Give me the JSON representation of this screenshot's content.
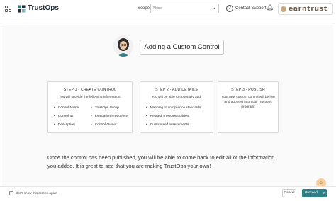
{
  "header": {
    "brand_name": "TrustOps",
    "scope_label": "Scope",
    "scope_value": "None",
    "contact_label": "Contact Support",
    "account_name": "earntrust"
  },
  "modal": {
    "title": "Adding a Custom Control",
    "steps": [
      {
        "title": "STEP 1 - CREATE CONTROL",
        "description": "You will provide the following information:",
        "items_col1": [
          "Control Name",
          "Control ID",
          "Description"
        ],
        "items_col2": [
          "TrustOps Group",
          "Evaluation Frequency",
          "Control Owner"
        ]
      },
      {
        "title": "STEP 2 - ADD DETAILS",
        "description": "You will be able to optionally add:",
        "items": [
          "Mapping to compliance standards",
          "Related TrustOps policies",
          "Custom self assessments"
        ]
      },
      {
        "title": "STEP 3 - PUBLISH",
        "description": "Your new custom control will be live and adopted into your TrustOps program!"
      }
    ],
    "bottom_text": "Once the control has been published, you will be able to come back to edit all of the information you added. It is great to see that you are making TrustOps your own!"
  },
  "footer": {
    "dont_show_label": "Don't show this screen again",
    "cancel_label": "Cancel",
    "proceed_label": "Proceed"
  },
  "colors": {
    "primary": "#2f7f86",
    "brand_text": "#1e2b3a"
  }
}
